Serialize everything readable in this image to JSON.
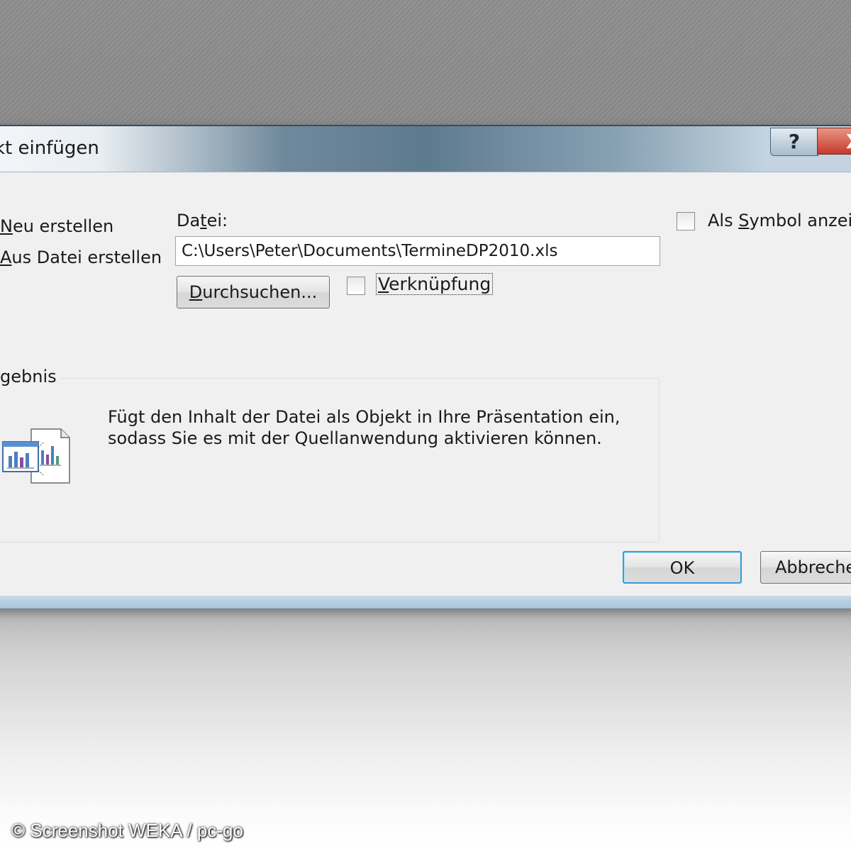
{
  "dialog": {
    "title": "kt einfügen",
    "help_label": "?",
    "close_label": "X"
  },
  "options": {
    "neu_erstellen": {
      "first": "N",
      "rest": "eu erstellen"
    },
    "aus_datei": {
      "first": "A",
      "rest": "us Datei erstellen"
    }
  },
  "file": {
    "label_before": "Da",
    "label_underlined": "t",
    "label_after": "ei:",
    "path": "C:\\Users\\Peter\\Documents\\TermineDP2010.xls"
  },
  "buttons": {
    "browse": {
      "first": "D",
      "rest": "urchsuchen..."
    },
    "ok": "OK",
    "cancel": "Abbreche"
  },
  "link_checkbox": {
    "first": "V",
    "rest": "erknüpfung",
    "checked": false
  },
  "symbol_checkbox": {
    "before": "Als ",
    "underlined": "S",
    "after": "ymbol anzeig",
    "checked": false
  },
  "result": {
    "title": "gebnis",
    "line1": "Fügt den Inhalt der Datei als Objekt in Ihre Präsentation ein,",
    "line2": "sodass Sie es mit der Quellanwendung aktivieren können."
  },
  "credit": "© Screenshot WEKA / pc-go",
  "icons": [
    "help-icon",
    "close-icon",
    "embedded-object-icon"
  ]
}
